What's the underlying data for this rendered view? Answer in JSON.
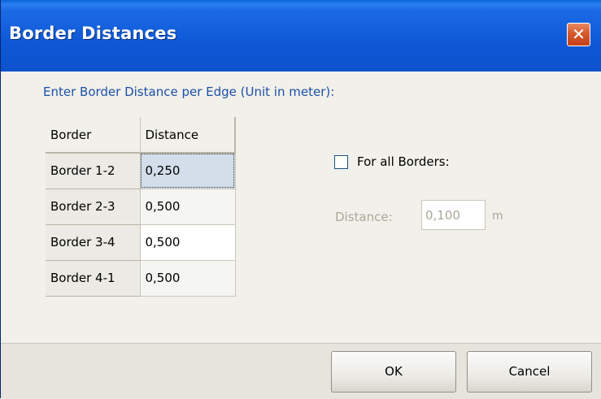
{
  "window": {
    "title": "Border Distances",
    "close_glyph": "✕"
  },
  "instruction": "Enter Border Distance per Edge  (Unit in meter):",
  "table": {
    "headers": [
      "Border",
      "Distance"
    ],
    "rows": [
      {
        "border": "Border 1-2",
        "distance": "0,250"
      },
      {
        "border": "Border 2-3",
        "distance": "0,500"
      },
      {
        "border": "Border 3-4",
        "distance": "0,500"
      },
      {
        "border": "Border 4-1",
        "distance": "0,500"
      }
    ]
  },
  "all_borders": {
    "label": "For all Borders:",
    "checked": false
  },
  "distance_field": {
    "label": "Distance:",
    "value": "0,100",
    "unit": "m",
    "enabled": false
  },
  "buttons": {
    "ok": "OK",
    "cancel": "Cancel"
  },
  "colors": {
    "titlebar": "#0d53cc",
    "instruction_text": "#1c4fa8",
    "disabled_text": "#aca899",
    "close_button": "#d55a2e"
  }
}
